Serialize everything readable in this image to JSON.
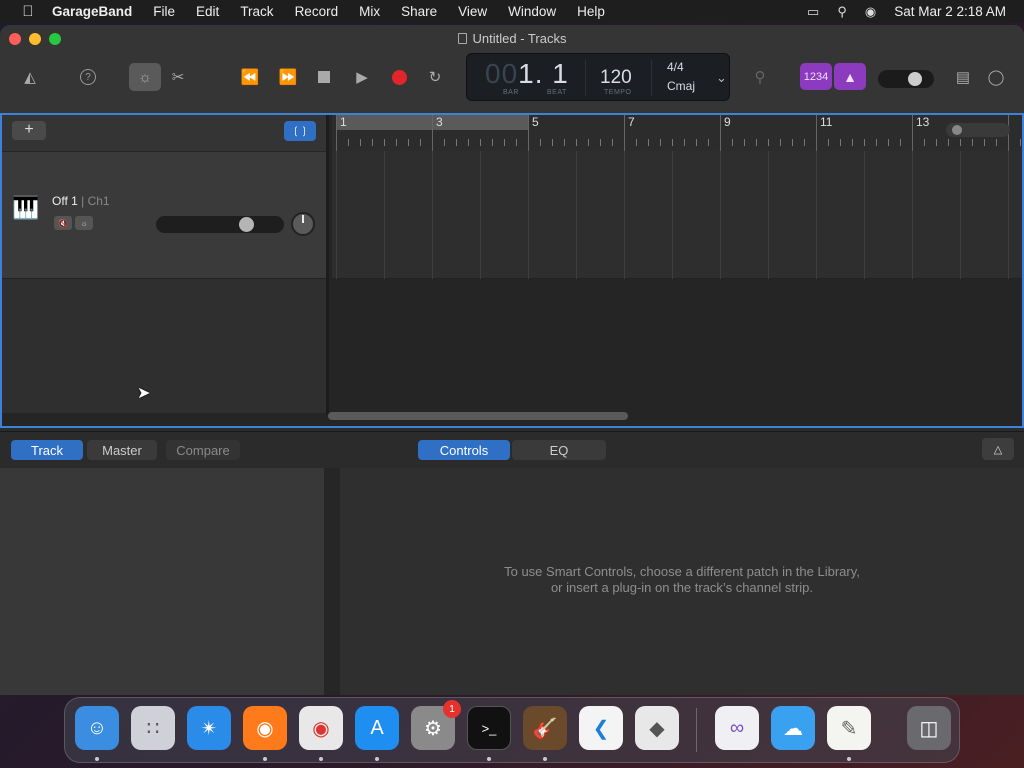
{
  "menubar": {
    "apple": "",
    "app_name": "GarageBand",
    "items": [
      "File",
      "Edit",
      "Track",
      "Record",
      "Mix",
      "Share",
      "View",
      "Window",
      "Help"
    ],
    "datetime": "Sat Mar 2  2:18 AM"
  },
  "window": {
    "title": "Untitled - Tracks"
  },
  "lcd": {
    "position_dim": "00",
    "position": "1. 1",
    "bar_label": "BAR",
    "beat_label": "BEAT",
    "tempo": "120",
    "tempo_label": "TEMPO",
    "time_signature": "4/4",
    "key": "Cmaj"
  },
  "toolbar": {
    "count_in": "1234",
    "volume_level": 0.75
  },
  "tracks": {
    "add_label": "+",
    "track1": {
      "name": "Off 1",
      "channel": "| Ch1",
      "volume_level": 0.72
    },
    "ruler_numbers": [
      "1",
      "3",
      "5",
      "7",
      "9",
      "11",
      "13"
    ]
  },
  "smart_controls": {
    "tabs": [
      "Track",
      "Master",
      "Compare"
    ],
    "view_tabs": [
      "Controls",
      "EQ"
    ],
    "message_line1": "To use Smart Controls, choose a different patch in the Library,",
    "message_line2": "or insert a plug-in on the track’s channel strip."
  },
  "dock": {
    "items": [
      "Finder",
      "Launchpad",
      "Safari",
      "Firefox",
      "Chrome",
      "App Store",
      "System Settings",
      "Terminal",
      "GarageBand",
      "VS Code",
      "Roblox",
      "Visual Studio",
      "Weather",
      "TextEdit",
      "Trash"
    ],
    "settings_badge": "1"
  },
  "colors": {
    "accent": "#2f6fc4",
    "record": "#e0262a",
    "purple": "#8c3bbf"
  }
}
